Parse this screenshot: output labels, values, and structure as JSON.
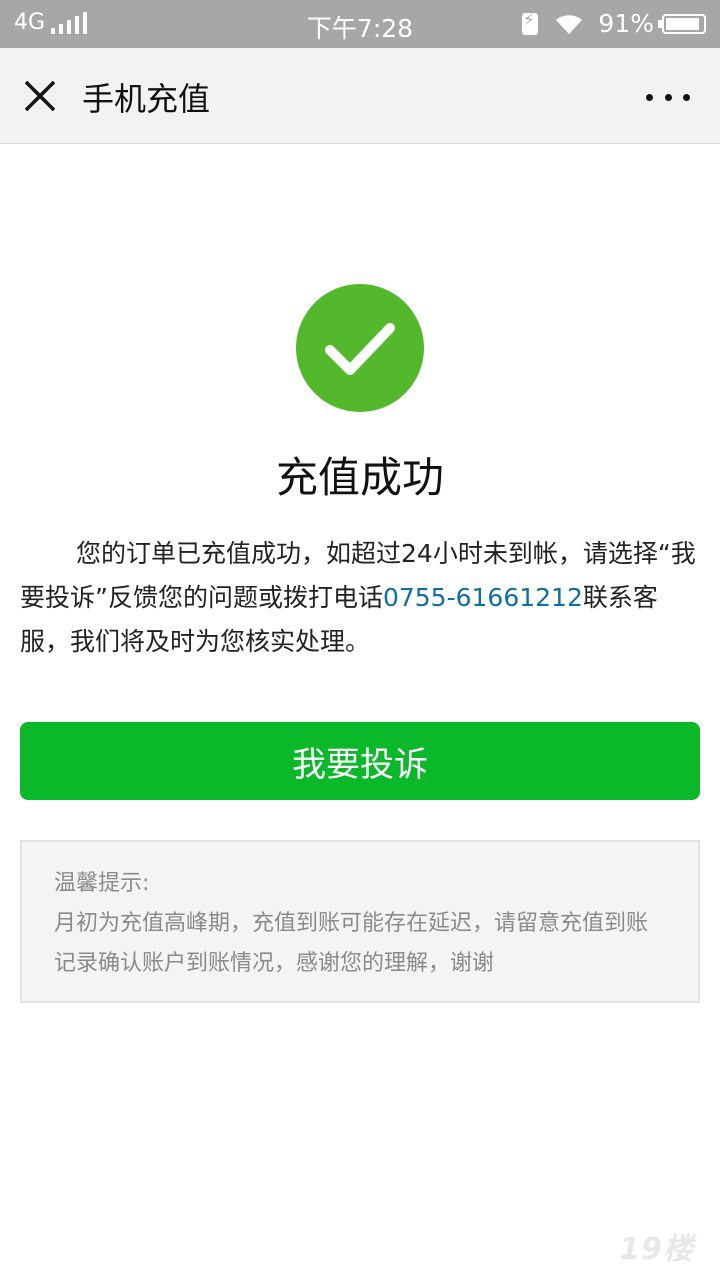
{
  "status_bar": {
    "network": "4G",
    "time": "下午7:28",
    "battery": "91%",
    "battery_level": 0.91
  },
  "navbar": {
    "title": "手机充值",
    "close_icon": "close-icon",
    "more_icon": "more-icon"
  },
  "result": {
    "title": "充值成功",
    "desc_before": "您的订单已充值成功，如超过24小时未到帐，请选择“我要投诉”反馈您的问题或拨打电话",
    "phone": "0755-61661212",
    "desc_after": "联系客服，我们将及时为您核实处理。",
    "icon": "check-circle-icon",
    "icon_color": "#53b82c"
  },
  "complain_button": {
    "label": "我要投诉",
    "color": "#0ab82a"
  },
  "tips": {
    "heading": "温馨提示:",
    "body": "月初为充值高峰期，充值到账可能存在延迟，请留意充值到账记录确认账户到账情况，感谢您的理解，谢谢"
  },
  "watermark": "19楼"
}
